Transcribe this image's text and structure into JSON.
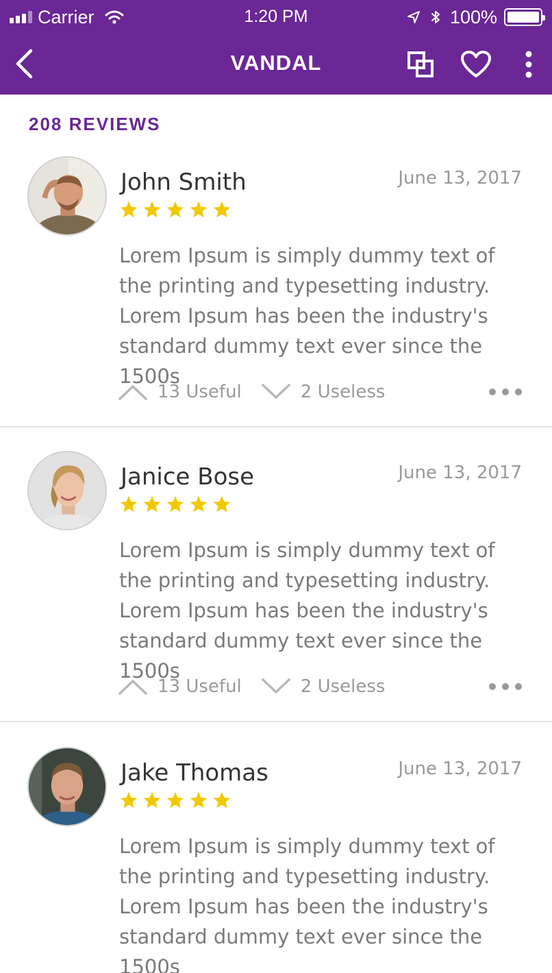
{
  "status_bar": {
    "carrier": "Carrier",
    "time": "1:20 PM",
    "battery": "100%"
  },
  "nav": {
    "title": "VANDAL",
    "icons": [
      "back-icon",
      "layers-icon",
      "heart-icon",
      "more-vertical-icon"
    ]
  },
  "reviews_count": "208 REVIEWS",
  "colors": {
    "brand": "#6a2795",
    "star": "#f2c800",
    "muted_text": "#7a7a7a"
  },
  "reviews": [
    {
      "name": "John Smith",
      "date": "June 13, 2017",
      "rating": 5,
      "text": "Lorem Ipsum is simply dummy text of the printing and typesetting industry. Lorem Ipsum has been the industry's standard dummy text ever since the 1500s",
      "useful": "13 Useful",
      "useless": "2 Useless"
    },
    {
      "name": "Janice Bose",
      "date": "June 13, 2017",
      "rating": 5,
      "text": "Lorem Ipsum is simply dummy text of the printing and typesetting industry. Lorem Ipsum has been the industry's standard dummy text ever since the 1500s",
      "useful": "13 Useful",
      "useless": "2 Useless"
    },
    {
      "name": "Jake Thomas",
      "date": "June 13, 2017",
      "rating": 5,
      "text": "Lorem Ipsum is simply dummy text of the printing and typesetting industry. Lorem Ipsum has been the industry's standard dummy text ever since the 1500s"
    }
  ]
}
